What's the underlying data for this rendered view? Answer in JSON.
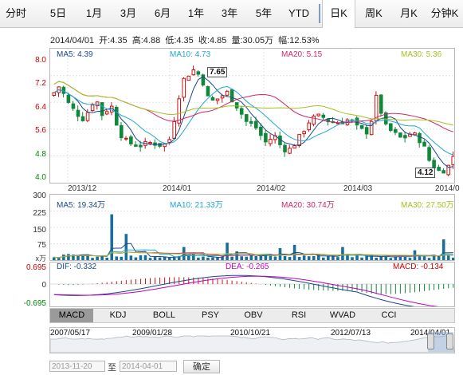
{
  "tabs": [
    {
      "label": "分时",
      "active": false
    },
    {
      "label": "5日",
      "active": false
    },
    {
      "label": "1月",
      "active": false
    },
    {
      "label": "3月",
      "active": false
    },
    {
      "label": "6月",
      "active": false
    },
    {
      "label": "1年",
      "active": false
    },
    {
      "label": "3年",
      "active": false
    },
    {
      "label": "5年",
      "active": false
    },
    {
      "label": "YTD",
      "active": false
    },
    {
      "label": "日K",
      "active": true
    },
    {
      "label": "周K",
      "active": false
    },
    {
      "label": "月K",
      "active": false
    },
    {
      "label": "分钟K",
      "active": false
    }
  ],
  "info_line": "2014/04/01  开:4.35  高:4.88  低:4.35  收:4.85  量:30.05万  幅:12.53%",
  "price_panel": {
    "ma5": "MA5: 4.39",
    "ma10": "MA10: 4.73",
    "ma20": "MA20: 5.15",
    "ma30": "MA30: 5.36",
    "y_ticks": [
      "8.0",
      "7.2",
      "6.4",
      "5.6",
      "4.8",
      "4.0"
    ],
    "x_ticks": [
      "2013/12",
      "2014/01",
      "2014/02",
      "2014/03",
      "2014/0"
    ],
    "high_marker": "7.65",
    "low_marker": "4.12"
  },
  "volume_panel": {
    "ma5": "MA5: 19.34万",
    "ma10": "MA10: 21.33万",
    "ma20": "MA20: 30.74万",
    "ma30": "MA30: 27.50万",
    "y_ticks": [
      "300",
      "225",
      "150",
      "75"
    ],
    "unit": "x万"
  },
  "macd_panel": {
    "dif": "DIF: -0.332",
    "dea": "DEA: -0.265",
    "macd": "MACD: -0.134",
    "y_ticks": [
      "0.695",
      "0",
      "-0.695"
    ]
  },
  "indicator_buttons": [
    {
      "label": "MACD",
      "active": true
    },
    {
      "label": "KDJ",
      "active": false
    },
    {
      "label": "BOLL",
      "active": false
    },
    {
      "label": "PSY",
      "active": false
    },
    {
      "label": "OBV",
      "active": false
    },
    {
      "label": "RSI",
      "active": false
    },
    {
      "label": "WVAD",
      "active": false
    },
    {
      "label": "CCI",
      "active": false
    }
  ],
  "navigator": {
    "dates": [
      "2007/05/17",
      "2009/01/28",
      "2010/10/21",
      "2012/07/13",
      "2014/04/01"
    ]
  },
  "range": {
    "from": "2013-11-20",
    "to_label": "至",
    "to": "2014-04-01",
    "confirm": "确定"
  },
  "colors": {
    "up": "#d01010",
    "down": "#10883a",
    "ma5": "#1a4a8a",
    "ma10": "#22a7d6",
    "ma20": "#d3246a",
    "ma30": "#a5c020",
    "vol": "#1a6e9c"
  },
  "chart_data": {
    "type": "candlestick",
    "title": "",
    "ylim": [
      4.0,
      8.0
    ],
    "high": 7.65,
    "low": 4.12,
    "last": {
      "date": "2014/04/01",
      "open": 4.35,
      "high": 4.88,
      "low": 4.35,
      "close": 4.85,
      "volume_wan": 30.05,
      "amplitude_pct": 12.53
    },
    "ma": {
      "MA5": 4.39,
      "MA10": 4.73,
      "MA20": 5.15,
      "MA30": 5.36
    }
  }
}
